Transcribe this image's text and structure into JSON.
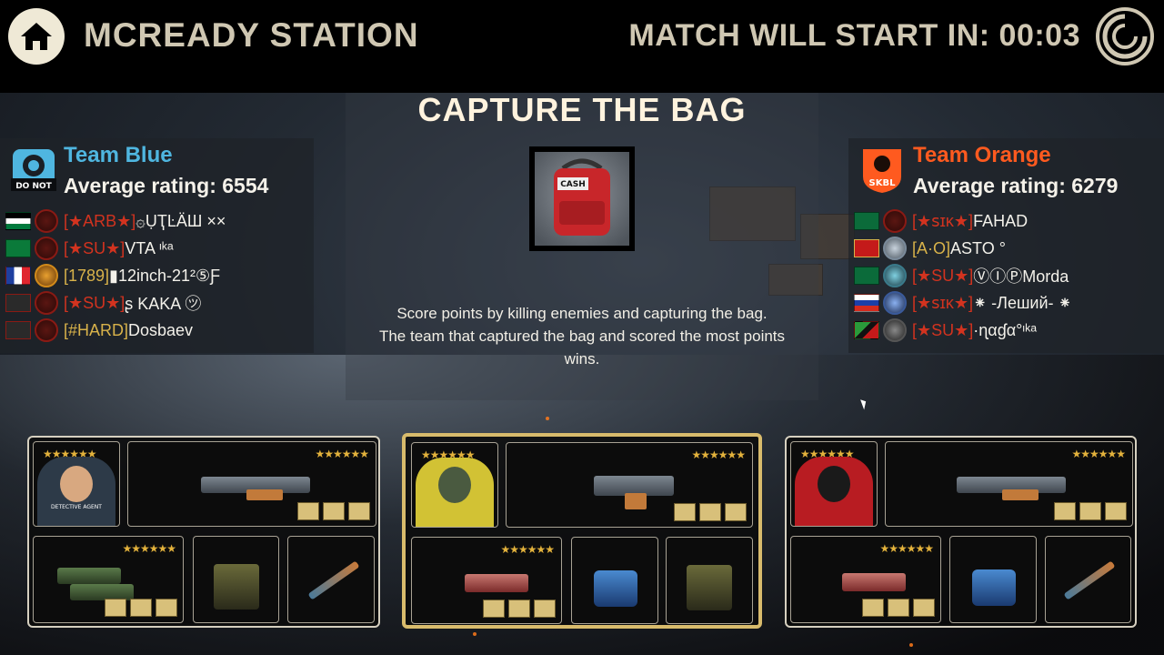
{
  "header": {
    "map_name": "MCREADY STATION",
    "countdown_label": "MATCH WILL START IN:",
    "countdown_time": "00:03"
  },
  "mode": {
    "title": "CAPTURE THE BAG",
    "bag_label": "CASH",
    "description_line1": "Score points by killing enemies and capturing the bag.",
    "description_line2": "The team that captured the bag and scored the most points",
    "description_line3": "wins."
  },
  "team_blue": {
    "name": "Team Blue",
    "emblem_text": "DO NOT",
    "rating": "Average rating: 6554",
    "color": "#4fb6e0",
    "players": [
      {
        "clan": "[★ARB★]",
        "name": "۞ỤҬĿÄШ ××",
        "flag": "jordan"
      },
      {
        "clan": "[★SU★]",
        "name": "VTA ᶦᵏᵃ",
        "flag": "mauritania"
      },
      {
        "clan": "[1789]",
        "name": "▮12inch-21²⑤Ƒ",
        "flag": "france"
      },
      {
        "clan": "[★SU★]",
        "name": "ʂ KAKA ㋡",
        "flag": "anarchy"
      },
      {
        "clan": "[#HARD]",
        "name": "Dosbaev",
        "flag": "anarchy"
      }
    ]
  },
  "team_orange": {
    "name": "Team Orange",
    "emblem_text": "SKBL",
    "rating": "Average rating: 6279",
    "color": "#ff5a1f",
    "players": [
      {
        "clan": "[★ꜱɪᴋ★]",
        "name": "FAHAD",
        "flag": "saudi"
      },
      {
        "clan": "[A·O]",
        "name": "ASTO °",
        "flag": "montenegro"
      },
      {
        "clan": "[★SU★]",
        "name": "ⓋⒾⓅMorda",
        "flag": "saudi"
      },
      {
        "clan": "[★ꜱɪᴋ★]",
        "name": "⁕ -Леший- ⁕",
        "flag": "russia"
      },
      {
        "clan": "[★SU★]",
        "name": "·ɳαɠα°ᶦᵏᵃ",
        "flag": "stkitts"
      }
    ]
  },
  "loadouts": [
    {
      "stars": "★★★★★★",
      "character": "agent",
      "patch": "DETECTIVE AGENT",
      "active": false
    },
    {
      "stars": "★★★★★★",
      "character": "firefighter",
      "patch": "",
      "active": true
    },
    {
      "stars": "★★★★★★",
      "character": "ninja",
      "patch": "",
      "active": false
    }
  ],
  "colors": {
    "accent_gold": "#d8bb6c",
    "header_text": "#cfc7b2",
    "clan_red": "#d2331f"
  }
}
